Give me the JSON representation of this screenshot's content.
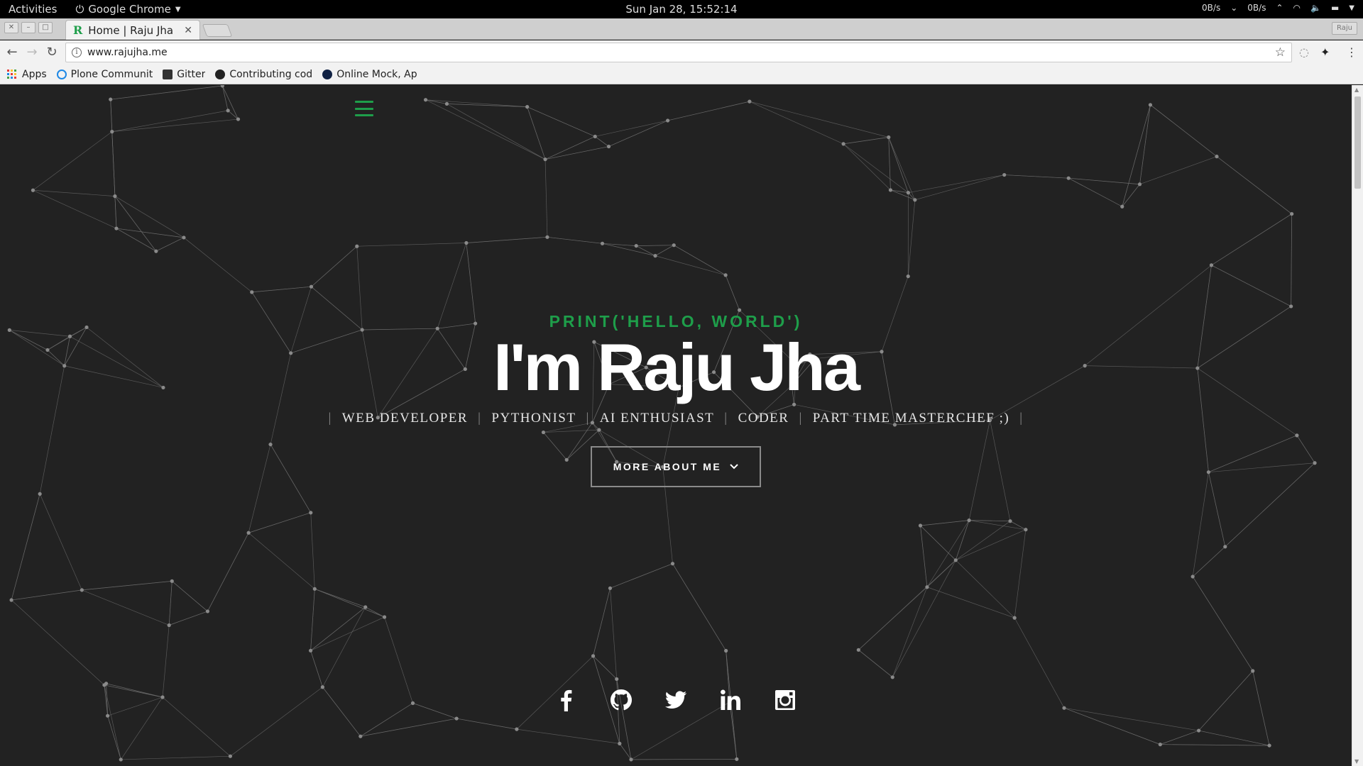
{
  "system_bar": {
    "activities": "Activities",
    "app_name": "Google Chrome",
    "datetime": "Sun Jan 28, 15:52:14",
    "net_down": "0B/s",
    "net_up": "0B/s"
  },
  "browser": {
    "tab_title": "Home | Raju Jha",
    "favicon_letter": "R",
    "url": "www.rajujha.me",
    "profile": "Raju",
    "bookmarks": [
      {
        "label": "Apps"
      },
      {
        "label": "Plone Communit"
      },
      {
        "label": "Gitter"
      },
      {
        "label": "Contributing cod"
      },
      {
        "label": "Online Mock, Ap"
      }
    ]
  },
  "hero": {
    "tagline": "PRINT('HELLO, WORLD')",
    "name": "I'm Raju Jha",
    "roles": [
      "WEB DEVELOPER",
      "PYTHONIST",
      "AI ENTHUSIAST",
      "CODER",
      "PART TIME MASTERCHEF ;)"
    ],
    "button_label": "MORE ABOUT ME"
  },
  "social": [
    {
      "name": "facebook-icon"
    },
    {
      "name": "github-icon"
    },
    {
      "name": "twitter-icon"
    },
    {
      "name": "linkedin-icon"
    },
    {
      "name": "instagram-icon"
    }
  ],
  "colors": {
    "accent": "#1e9e4a",
    "page_bg": "#222222",
    "network": "#6a6a6a"
  }
}
